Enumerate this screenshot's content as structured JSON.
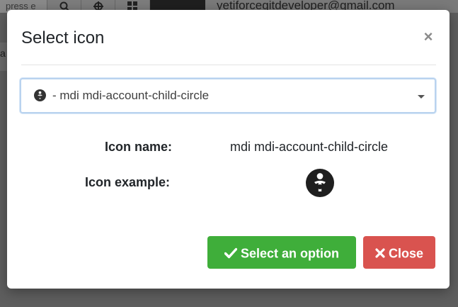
{
  "background": {
    "search_text": "press e",
    "email": "yetiforcegitdeveloper@gmail.com",
    "left_fragment": "a"
  },
  "modal": {
    "title": "Select icon",
    "close_symbol": "×",
    "select": {
      "selected_text": "- mdi mdi-account-child-circle",
      "icon": "account-child-circle-icon"
    },
    "icon_name_label": "Icon name:",
    "icon_name_value": "mdi mdi-account-child-circle",
    "icon_example_label": "Icon example:",
    "select_button_label": "Select an option",
    "close_button_label": "Close"
  },
  "colors": {
    "primary_green": "#3fae3a",
    "danger_red": "#d9534f",
    "focus_border": "#b9d3ef"
  }
}
